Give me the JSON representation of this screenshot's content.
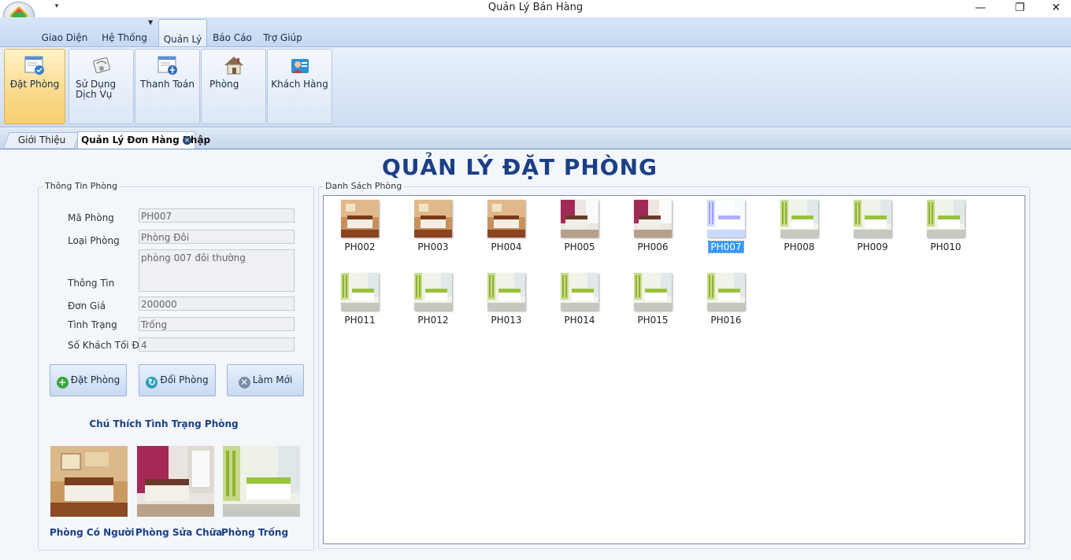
{
  "window": {
    "title": "Quản Lý Bán Hàng",
    "qat_arrow": "▾",
    "minimize": "—",
    "restore": "❐",
    "close": "✕"
  },
  "ribbon": {
    "tabs": [
      {
        "label": "Giao Diện"
      },
      {
        "label": "Hệ Thống"
      },
      {
        "label": "Quản Lý"
      },
      {
        "label": "Báo Cáo"
      },
      {
        "label": "Trợ Giúp"
      }
    ],
    "active_tab": "Quản Lý",
    "buttons": [
      {
        "label": "Đặt Phòng",
        "icon": "booking-icon"
      },
      {
        "label_line1": "Sử Dụng",
        "label_line2": "Dịch Vụ",
        "icon": "service-icon"
      },
      {
        "label": "Thanh Toán",
        "icon": "payment-icon"
      },
      {
        "label": "Phòng",
        "icon": "house-icon"
      },
      {
        "label": "Khách Hàng",
        "icon": "customer-icon"
      }
    ]
  },
  "doc_tabs": [
    {
      "label": "Giới Thiệu"
    },
    {
      "label": "Quản Lý Đơn Hàng Nhập",
      "close_glyph": "✕"
    }
  ],
  "page": {
    "title": "QUẢN LÝ ĐẶT PHÒNG"
  },
  "room_info": {
    "group_label": "Thông Tin Phòng",
    "fields": {
      "ma_phong": {
        "label": "Mã Phòng",
        "value": "PH007"
      },
      "loai_phong": {
        "label": "Loại Phòng",
        "value": "Phòng Đôi"
      },
      "thong_tin": {
        "label": "Thông Tin",
        "value": "phòng 007 đôi thường"
      },
      "don_gia": {
        "label": "Đơn Giá",
        "value": "200000"
      },
      "tinh_trang": {
        "label": "Tình Trạng",
        "value": "Trống"
      },
      "so_khach": {
        "label": "Số Khách Tối Đa",
        "value": "4"
      }
    },
    "buttons": {
      "dat_phong": "Đặt Phòng",
      "doi_phong": "Đổi Phòng",
      "lam_moi": "Làm Mới"
    },
    "legend": {
      "title": "Chú Thích Tình Trạng Phòng",
      "items": [
        {
          "label": "Phòng Có Người",
          "status": "occupied"
        },
        {
          "label": "Phòng Sửa Chữa",
          "status": "repair"
        },
        {
          "label": "Phòng Trống",
          "status": "empty"
        }
      ]
    }
  },
  "room_list": {
    "group_label": "Danh Sách Phòng",
    "selected": "PH007",
    "rooms": [
      {
        "id": "PH002",
        "status": "occupied"
      },
      {
        "id": "PH003",
        "status": "occupied"
      },
      {
        "id": "PH004",
        "status": "occupied"
      },
      {
        "id": "PH005",
        "status": "repair"
      },
      {
        "id": "PH006",
        "status": "repair"
      },
      {
        "id": "PH007",
        "status": "empty"
      },
      {
        "id": "PH008",
        "status": "empty"
      },
      {
        "id": "PH009",
        "status": "empty"
      },
      {
        "id": "PH010",
        "status": "empty"
      },
      {
        "id": "PH011",
        "status": "empty"
      },
      {
        "id": "PH012",
        "status": "empty"
      },
      {
        "id": "PH013",
        "status": "empty"
      },
      {
        "id": "PH014",
        "status": "empty"
      },
      {
        "id": "PH015",
        "status": "empty"
      },
      {
        "id": "PH016",
        "status": "empty"
      }
    ]
  },
  "colors": {
    "title": "#1b3f86",
    "selection": "#3399ff",
    "occupied": "#b5562a",
    "repair": "#b5356a",
    "empty": "#a8c83a"
  }
}
